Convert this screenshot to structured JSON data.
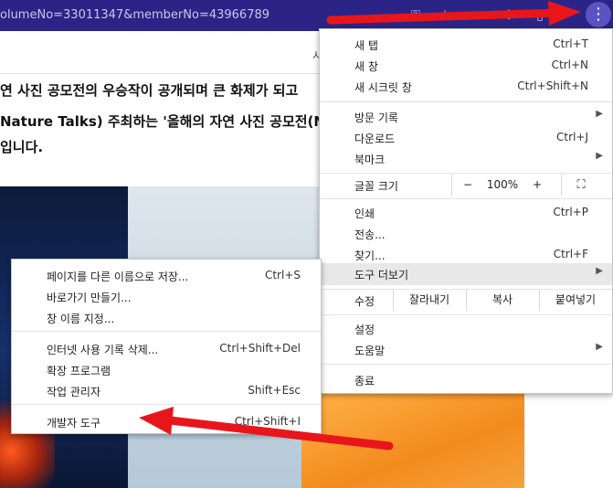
{
  "browser": {
    "url_fragment": "olumeNo=33011347&memberNo=43966789",
    "icons": [
      "key-icon",
      "star-icon",
      "tab-search-icon",
      "extensions-icon",
      "profile-icon"
    ],
    "more_icon": "⋮",
    "page_label": "시"
  },
  "page": {
    "lines": [
      "연 사진 공모전의 우승작이 공개되며 큰 화제가 되고",
      "Nature Talks) 주최하는 '올해의 자연 사진 공모전(N",
      "입니다."
    ]
  },
  "menu": {
    "items_group1": [
      {
        "label": "새 탭",
        "shortcut": "Ctrl+T"
      },
      {
        "label": "새 창",
        "shortcut": "Ctrl+N"
      },
      {
        "label": "새 시크릿 창",
        "shortcut": "Ctrl+Shift+N"
      }
    ],
    "items_group2": [
      {
        "label": "방문 기록",
        "shortcut": ""
      },
      {
        "label": "다운로드",
        "shortcut": "Ctrl+J"
      },
      {
        "label": "북마크",
        "shortcut": ""
      }
    ],
    "zoom": {
      "label": "글꼴 크기",
      "minus": "−",
      "value": "100%",
      "plus": "+"
    },
    "items_group3": [
      {
        "label": "인쇄",
        "shortcut": "Ctrl+P"
      },
      {
        "label": "전송...",
        "shortcut": ""
      },
      {
        "label": "찾기...",
        "shortcut": "Ctrl+F"
      },
      {
        "label": "도구 더보기",
        "shortcut": ""
      }
    ],
    "edit": {
      "label": "수정",
      "cut": "잘라내기",
      "copy": "복사",
      "paste": "붙여넣기"
    },
    "items_group4": [
      {
        "label": "설정",
        "shortcut": ""
      },
      {
        "label": "도움말",
        "shortcut": ""
      }
    ],
    "exit": {
      "label": "종료"
    }
  },
  "submenu": {
    "items": [
      {
        "label": "페이지를 다른 이름으로 저장...",
        "shortcut": "Ctrl+S"
      },
      {
        "label": "바로가기 만들기...",
        "shortcut": ""
      },
      {
        "label": "창 이름 지정...",
        "shortcut": ""
      },
      {
        "label": "인터넷 사용 기록 삭제...",
        "shortcut": "Ctrl+Shift+Del"
      },
      {
        "label": "확장 프로그램",
        "shortcut": ""
      },
      {
        "label": "작업 관리자",
        "shortcut": "Shift+Esc"
      },
      {
        "label": "개발자 도구",
        "shortcut": "Ctrl+Shift+I"
      }
    ]
  },
  "colors": {
    "toolbar": "#2b2486",
    "annotation_arrow": "#e8161b",
    "highlight": "#e8e8e8"
  }
}
